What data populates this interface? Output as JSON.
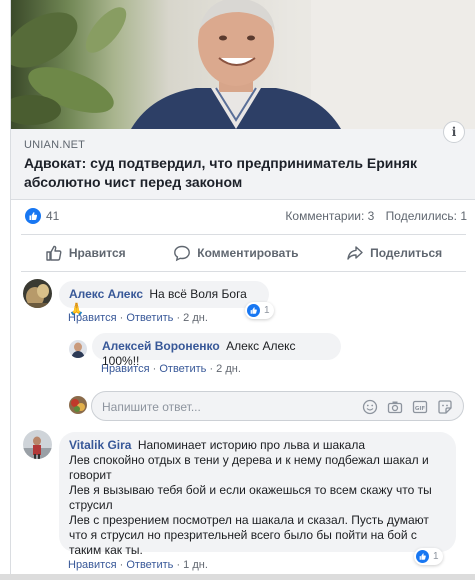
{
  "preview": {
    "source": "UNIAN.NET",
    "headline": "Адвокат: суд подтвердил, что предприниматель Ериняк абсолютно чист перед законом",
    "info_icon": "info-icon"
  },
  "reactions": {
    "like_count": "41",
    "comments": "Комментарии: 3",
    "shares": "Поделились: 1"
  },
  "actions": {
    "like": "Нравится",
    "comment": "Комментировать",
    "share": "Поделиться"
  },
  "comments": [
    {
      "author": "Алекс Алекс",
      "text": "На всё Воля Бога 🙏",
      "like_label": "Нравится",
      "reply_label": "Ответить",
      "time": "2 дн.",
      "reaction_count": "1"
    },
    {
      "author": "Алексей Вороненко",
      "text": "Алекс Алекс 100%!!",
      "like_label": "Нравится",
      "reply_label": "Ответить",
      "time": "2 дн."
    },
    {
      "author": "Vitalik Gira",
      "text_lines": [
        "Напоминает историю про льва и шакала",
        "Лев спокойно отдых в тени у дерева и к нему подбежал шакал и",
        "говорит",
        "Лев я вызываю тебя бой и если окажешься то всем скажу что ты",
        "струсил",
        "Лев с презрением посмотрел на шакала и сказал. Пусть думают",
        "что я струсил но презрительней всего было бы пойти на бой с",
        "таким как ты."
      ],
      "like_label": "Нравится",
      "reply_label": "Ответить",
      "time": "1 дн.",
      "reaction_count": "1"
    }
  ],
  "reply_box": {
    "placeholder": "Напишите ответ...",
    "icons": [
      "emoji-icon",
      "camera-icon",
      "gif-icon",
      "sticker-icon"
    ]
  },
  "separator": "·",
  "colors": {
    "link": "#385898",
    "like_blue": "#1877f2",
    "bubble_bg": "#f2f3f5",
    "muted": "#606770"
  }
}
